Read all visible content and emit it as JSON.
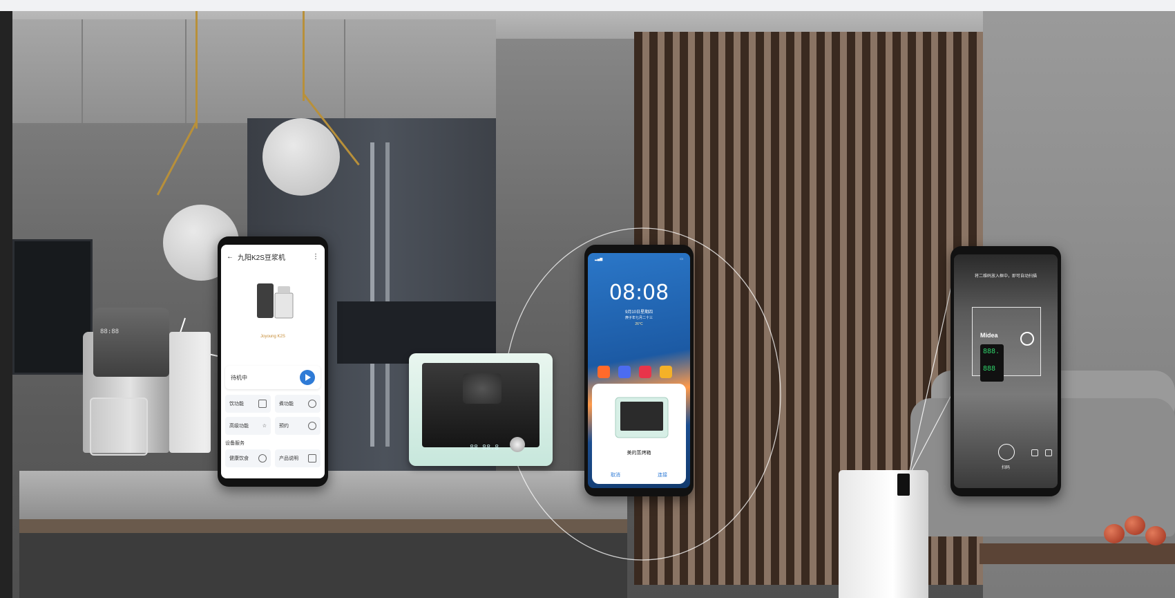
{
  "phone_app": {
    "title": "九阳K2S豆浆机",
    "model": "Joyoung K2S",
    "status": "待机中",
    "features": [
      {
        "label": "饮功能"
      },
      {
        "label": "煮功能"
      },
      {
        "label": "高级功能"
      },
      {
        "label": "预约"
      }
    ],
    "section": "设备服务",
    "services": [
      {
        "label": "健康饮食"
      },
      {
        "label": "产品说明"
      }
    ]
  },
  "phone_lock": {
    "time": "08:08",
    "date": "9月10日星期四",
    "subdate": "庚子年七月二十三",
    "weather": "26°C",
    "dialog_title": "美的蒸烤箱",
    "cancel": "取消",
    "confirm": "连接"
  },
  "phone_scan": {
    "hint": "将二维码放入框中，即可自动扫描",
    "brand": "Midea",
    "digits_top": "888.",
    "digits_bottom": "888",
    "scan_label": "扫码"
  },
  "soymilk_display": "88:88",
  "oven_display": "88 88.8",
  "colors": {
    "accent": "#2f7bd6",
    "digits": "#2fd36a",
    "model": "#c58b34"
  }
}
